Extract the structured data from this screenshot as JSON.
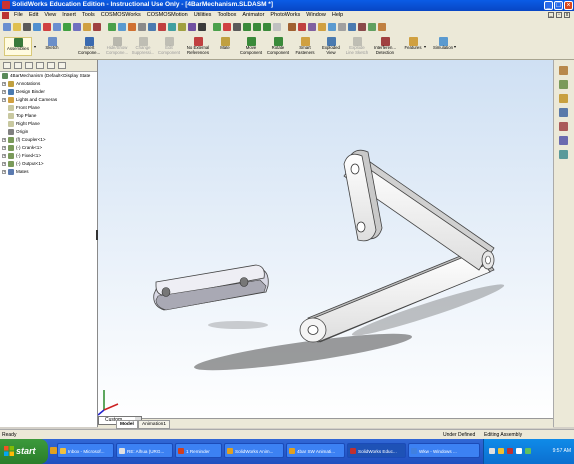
{
  "window": {
    "title": "SolidWorks Education Edition - Instructional Use Only - [4BarMechanism.SLDASM *]"
  },
  "menu": [
    "File",
    "Edit",
    "View",
    "Insert",
    "Tools",
    "COSMOSWorks",
    "COSMOSMotion",
    "Utilities",
    "Toolbox",
    "Animator",
    "PhotoWorks",
    "Window",
    "Help"
  ],
  "command_manager": {
    "assemblies": "Assemblies",
    "sketch": "Sketch",
    "buttons": [
      {
        "label1": "Insert",
        "label2": "Compone...",
        "disabled": false
      },
      {
        "label1": "Hide/Show",
        "label2": "Compone...",
        "disabled": true
      },
      {
        "label1": "Change",
        "label2": "Suppressi...",
        "disabled": true
      },
      {
        "label1": "Edit",
        "label2": "Component",
        "disabled": true
      },
      {
        "label1": "No External",
        "label2": "References",
        "disabled": false
      },
      {
        "label1": "Mate",
        "label2": "",
        "disabled": false
      },
      {
        "label1": "Move",
        "label2": "Component",
        "disabled": false
      },
      {
        "label1": "Rotate",
        "label2": "Component",
        "disabled": false
      },
      {
        "label1": "Smart",
        "label2": "Fasteners",
        "disabled": false
      },
      {
        "label1": "Exploded",
        "label2": "View",
        "disabled": false
      },
      {
        "label1": "Explode",
        "label2": "Line Sketch",
        "disabled": true
      },
      {
        "label1": "Interferen...",
        "label2": "Detection",
        "disabled": false
      },
      {
        "label1": "Features",
        "label2": "",
        "disabled": false
      },
      {
        "label1": "Simulation",
        "label2": "",
        "disabled": false
      }
    ]
  },
  "feature_tree": {
    "root": "4BarMechanism  (Default<Display State",
    "items": [
      {
        "label": "Annotations",
        "expander": "+",
        "indent": 1
      },
      {
        "label": "Design Binder",
        "expander": "+",
        "indent": 1
      },
      {
        "label": "Lights and Cameras",
        "expander": "+",
        "indent": 1
      },
      {
        "label": "Front Plane",
        "expander": "",
        "indent": 1
      },
      {
        "label": "Top Plane",
        "expander": "",
        "indent": 1
      },
      {
        "label": "Right Plane",
        "expander": "",
        "indent": 1
      },
      {
        "label": "Origin",
        "expander": "",
        "indent": 1
      },
      {
        "label": "(f) Coupler<1>",
        "expander": "+",
        "indent": 1
      },
      {
        "label": "(-) Crank<1>",
        "expander": "+",
        "indent": 1
      },
      {
        "label": "(-) Fixed<1>",
        "expander": "+",
        "indent": 1
      },
      {
        "label": "(-) Output<1>",
        "expander": "+",
        "indent": 1
      },
      {
        "label": "Mates",
        "expander": "+",
        "indent": 1
      }
    ]
  },
  "configuration": "Custom",
  "bottom_tabs": [
    "Model",
    "Animation1"
  ],
  "status": {
    "left": "Ready",
    "under_defined": "Under Defined",
    "editing": "Editing Assembly"
  },
  "taskbar": {
    "start": "start",
    "tasks": [
      {
        "label": "Inbox - Microsof...",
        "color": "#f0c040",
        "active": false
      },
      {
        "label": "RE: Alhua (URG...",
        "color": "#e0e0e0",
        "active": false
      },
      {
        "label": "1 Reminder",
        "color": "#d04020",
        "active": false
      },
      {
        "label": "SolidWorks Anim...",
        "color": "#e0a020",
        "active": false
      },
      {
        "label": "4bar SW Animati...",
        "color": "#e0a020",
        "active": false
      },
      {
        "label": "SolidWorks Educ...",
        "color": "#c03030",
        "active": true
      },
      {
        "label": "Wkw - Windows ...",
        "color": "#4080e0",
        "active": false
      }
    ],
    "clock": "9:57 AM"
  },
  "colors": {
    "title_bar": "#0a5ce6",
    "viewport_top": "#cfe0f3",
    "part_fill": "#f7f7f7",
    "part_edge": "#444444",
    "coupler_fill": "#e6e6ee",
    "taskbar": "#3168d5",
    "start_button": "#3c9a3c"
  }
}
